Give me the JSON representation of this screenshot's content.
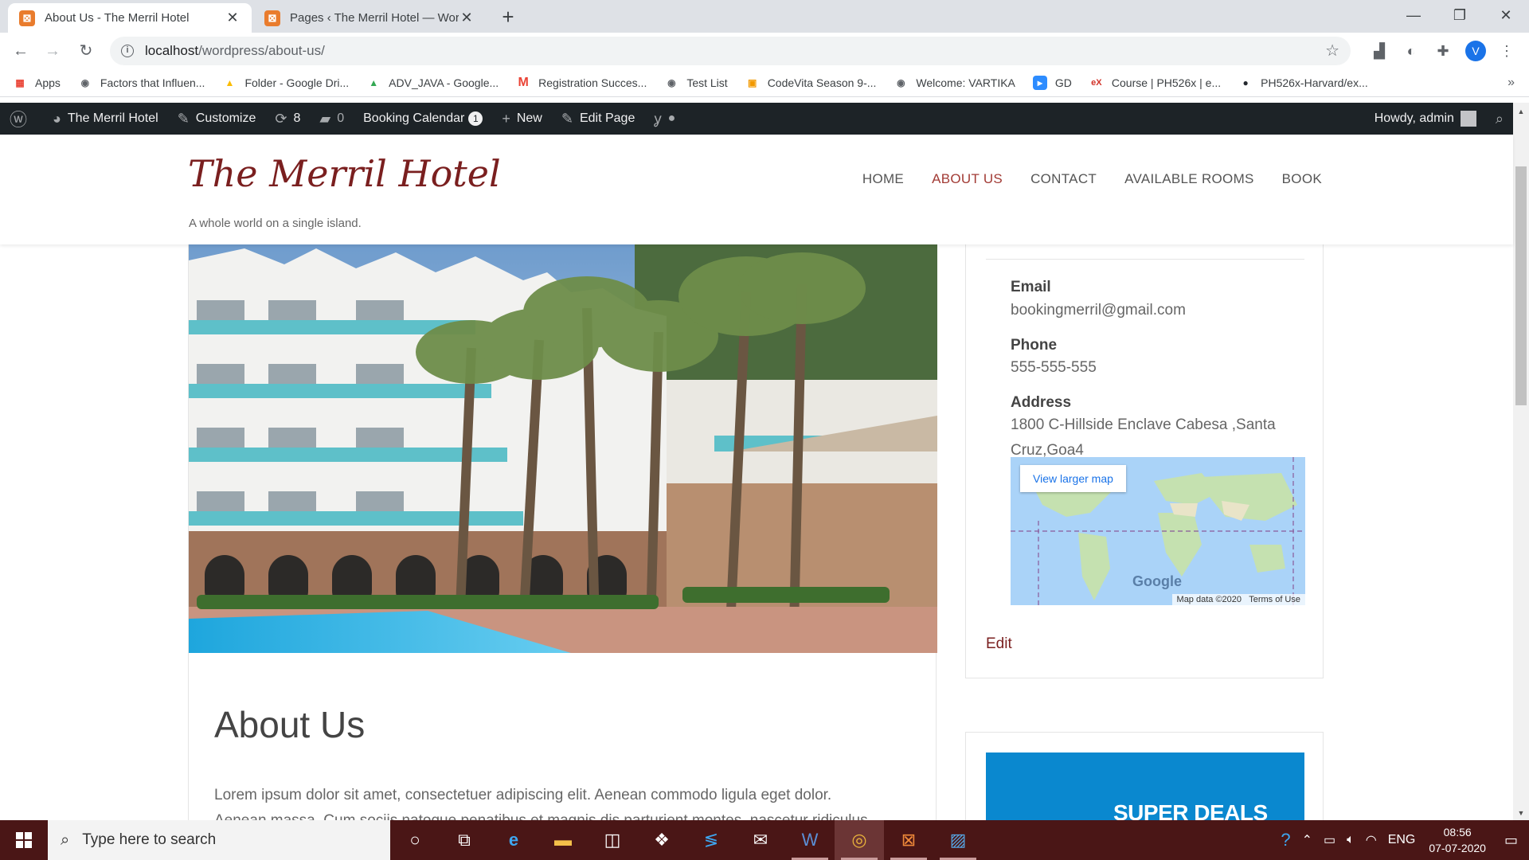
{
  "browser": {
    "tabs": [
      {
        "title": "About Us - The Merril Hotel",
        "favicon": "xampp-icon",
        "active": true
      },
      {
        "title": "Pages ‹ The Merril Hotel — Word",
        "favicon": "xampp-icon",
        "active": false
      }
    ],
    "url_host": "localhost",
    "url_path": "/wordpress/about-us/",
    "profile_initial": "V",
    "bookmarks": [
      {
        "label": "Apps",
        "icon": "apps-grid-icon"
      },
      {
        "label": "Factors that Influen...",
        "icon": "globe-icon"
      },
      {
        "label": "Folder - Google Dri...",
        "icon": "google-drive-icon"
      },
      {
        "label": "ADV_JAVA - Google...",
        "icon": "google-drive-icon"
      },
      {
        "label": "Registration Succes...",
        "icon": "gmail-icon"
      },
      {
        "label": "Test List",
        "icon": "globe-icon"
      },
      {
        "label": "CodeVita Season 9-...",
        "icon": "codevita-icon"
      },
      {
        "label": "Welcome: VARTIKA",
        "icon": "globe-icon"
      },
      {
        "label": "GD",
        "icon": "zoom-icon"
      },
      {
        "label": "Course | PH526x | e...",
        "icon": "edx-icon"
      },
      {
        "label": "PH526x-Harvard/ex...",
        "icon": "github-icon"
      }
    ]
  },
  "adminbar": {
    "site": "The Merril Hotel",
    "customize": "Customize",
    "updates": "8",
    "comments": "0",
    "booking": "Booking Calendar",
    "booking_badge": "1",
    "new": "New",
    "edit": "Edit Page",
    "howdy": "Howdy, admin"
  },
  "site": {
    "title": "The Merril Hotel",
    "tagline": "A whole world on a single island.",
    "nav": [
      {
        "label": "HOME",
        "current": false
      },
      {
        "label": "ABOUT US",
        "current": true
      },
      {
        "label": "CONTACT",
        "current": false
      },
      {
        "label": "AVAILABLE ROOMS",
        "current": false
      },
      {
        "label": "BOOK",
        "current": false
      }
    ]
  },
  "page": {
    "heading": "About Us",
    "body_line1": "Lorem ipsum dolor sit amet, consectetuer adipiscing elit. Aenean commodo ligula eget dolor.",
    "body_line2": "Aenean massa. Cum sociis natoque penatibus et magnis dis parturient montes, nascetur ridiculus"
  },
  "contact_widget": {
    "email_label": "Email",
    "email": "bookingmerril@gmail.com",
    "phone_label": "Phone",
    "phone": "555-555-555",
    "address_label": "Address",
    "address_line1": "1800 C-Hillside Enclave Cabesa ,Santa",
    "address_line2": "Cruz,Goa4",
    "map_link": "View larger map",
    "map_brand": "Google",
    "map_data": "Map data ©2020",
    "map_terms": "Terms of Use",
    "edit": "Edit"
  },
  "promo_widget": {
    "text": "SUPER DEALS"
  },
  "taskbar": {
    "search_placeholder": "Type here to search",
    "lang": "ENG",
    "time": "08:56",
    "date": "07-07-2020"
  },
  "colors": {
    "title_red": "#7a1f1f",
    "nav_current": "#a23b35",
    "adminbar": "#1d2327",
    "taskbar": "#4a1616",
    "promo_blue": "#0a88cf"
  }
}
